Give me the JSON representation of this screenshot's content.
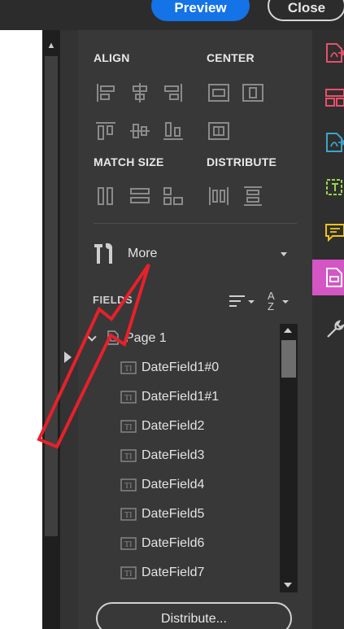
{
  "header": {
    "preview_label": "Preview",
    "close_label": "Close"
  },
  "panel": {
    "align_label": "ALIGN",
    "center_label": "CENTER",
    "match_size_label": "MATCH SIZE",
    "distribute_label": "DISTRIBUTE",
    "more_label": "More",
    "fields_label": "FIELDS",
    "distribute_button": "Distribute..."
  },
  "tree": {
    "page_label": "Page 1",
    "fields": [
      {
        "label": "DateField1#0"
      },
      {
        "label": "DateField1#1"
      },
      {
        "label": "DateField2"
      },
      {
        "label": "DateField3"
      },
      {
        "label": "DateField4"
      },
      {
        "label": "DateField5"
      },
      {
        "label": "DateField6"
      },
      {
        "label": "DateField7"
      }
    ]
  },
  "rail": {
    "tools": [
      {
        "icon": "export-pdf-icon",
        "color": "#e8506a"
      },
      {
        "icon": "organize-pages-icon",
        "color": "#e8506a"
      },
      {
        "icon": "create-pdf-icon",
        "color": "#3aa6c8"
      },
      {
        "icon": "edit-pdf-icon",
        "color": "#9bd44a"
      },
      {
        "icon": "comment-icon",
        "color": "#f2c21b"
      },
      {
        "icon": "prepare-form-icon",
        "color": "#ffffff",
        "active": true
      },
      {
        "icon": "more-tools-icon",
        "color": "#cfcfcf"
      }
    ]
  },
  "colors": {
    "accent": "#1473e6",
    "active_tool": "#d456c4",
    "annotation": "#e8202a"
  }
}
